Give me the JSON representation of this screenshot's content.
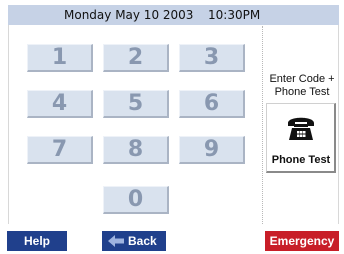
{
  "header": {
    "date": "Monday May 10  2003",
    "time": "10:30PM"
  },
  "keypad": {
    "keys": [
      "1",
      "2",
      "3",
      "4",
      "5",
      "6",
      "7",
      "8",
      "9",
      "0"
    ]
  },
  "side_panel": {
    "label_line1": "Enter Code +",
    "label_line2": "Phone Test",
    "button_label": "Phone Test",
    "button_icon": "telephone-icon"
  },
  "footer": {
    "help_label": "Help",
    "back_label": "Back",
    "emergency_label": "Emergency"
  },
  "colors": {
    "header_bg": "#c6d2e6",
    "key_bg": "#d9e2ee",
    "key_text": "#8998b0",
    "nav_button": "#20408c",
    "emergency_button": "#c81e28"
  }
}
